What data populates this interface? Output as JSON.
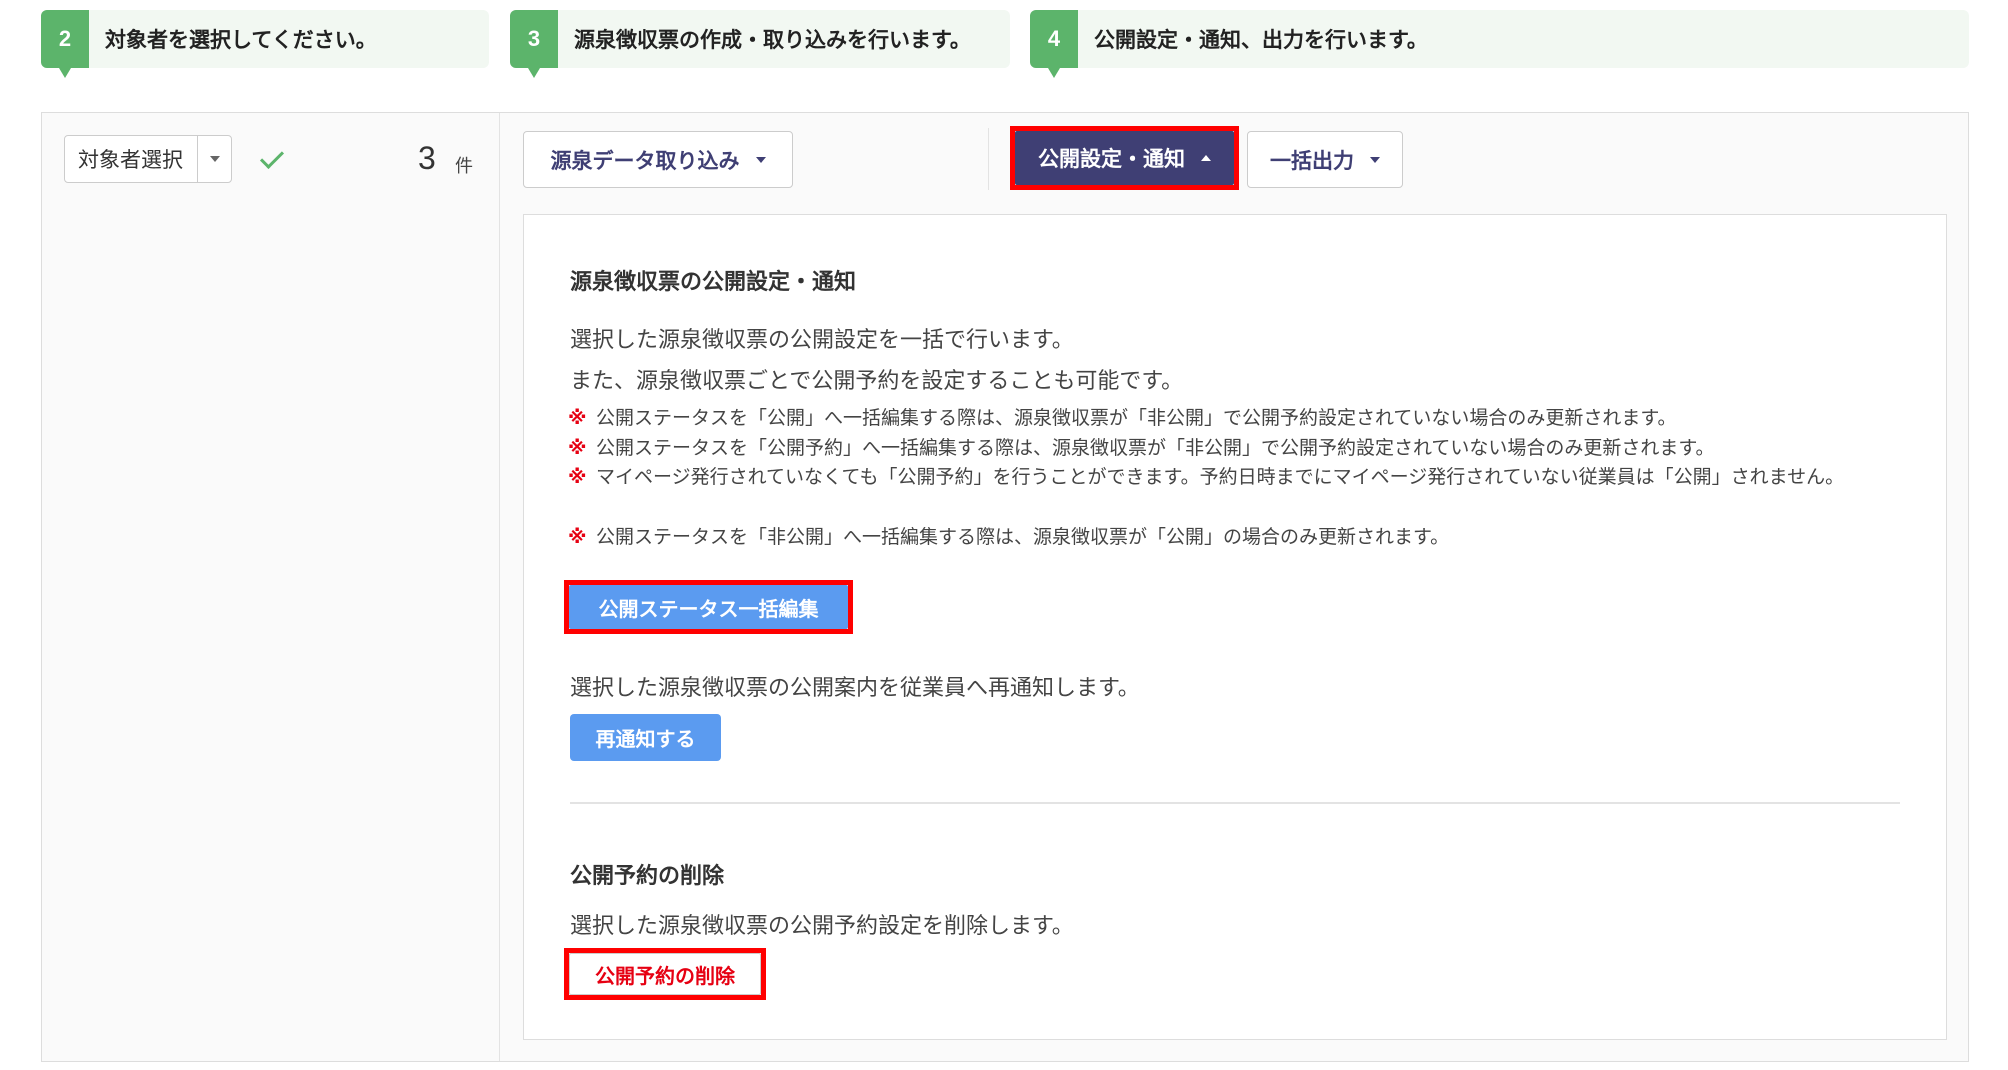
{
  "steps": [
    {
      "num": "2",
      "text": "対象者を選択してください。"
    },
    {
      "num": "3",
      "text": "源泉徴収票の作成・取り込みを行います。"
    },
    {
      "num": "4",
      "text": "公開設定・通知、出力を行います。"
    }
  ],
  "left": {
    "select_label": "対象者選択",
    "count": "3",
    "count_unit": "件"
  },
  "toolbar": {
    "import_label": "源泉データ取り込み",
    "publish_label": "公開設定・通知",
    "export_label": "一括出力"
  },
  "section1": {
    "title": "源泉徴収票の公開設定・通知",
    "desc1": "選択した源泉徴収票の公開設定を一括で行います。",
    "desc2": "また、源泉徴収票ごとで公開予約を設定することも可能です。",
    "note_mark": "※",
    "notes": [
      "公開ステータスを「公開」へ一括編集する際は、源泉徴収票が「非公開」で公開予約設定されていない場合のみ更新されます。",
      "公開ステータスを「公開予約」へ一括編集する際は、源泉徴収票が「非公開」で公開予約設定されていない場合のみ更新されます。",
      "マイページ発行されていなくても「公開予約」を行うことができます。予約日時までにマイページ発行されていない従業員は「公開」されません。",
      "公開ステータスを「非公開」へ一括編集する際は、源泉徴収票が「公開」の場合のみ更新されます。"
    ],
    "bulk_edit_label": "公開ステータス一括編集",
    "renotify_desc": "選択した源泉徴収票の公開案内を従業員へ再通知します。",
    "renotify_label": "再通知する"
  },
  "section2": {
    "title": "公開予約の削除",
    "desc": "選択した源泉徴収票の公開予約設定を削除します。",
    "delete_label": "公開予約の削除"
  },
  "colors": {
    "green": "#5cb46b",
    "navy": "#3f3f74",
    "blue": "#5b9bf0",
    "red": "#e60012"
  }
}
